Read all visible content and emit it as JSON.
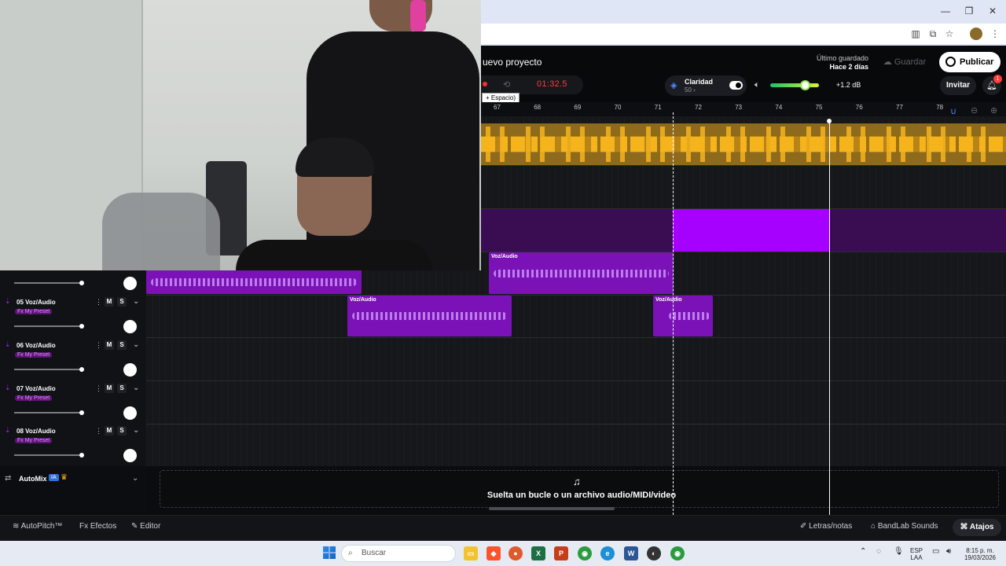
{
  "project": {
    "title": "uevo proyecto",
    "last_saved_label": "Último guardado",
    "last_saved_value": "Hace 2 días",
    "save_label": "Guardar",
    "publish_label": "Publicar",
    "invite_label": "Invitar",
    "notifications_count": "1"
  },
  "transport": {
    "time": "01:32.5",
    "tooltip": "+ Espacio)"
  },
  "clarity": {
    "label": "Claridad",
    "value": "50 ›"
  },
  "master": {
    "gain": "+1.2 dB",
    "volume_level": 0.7
  },
  "ruler": {
    "ticks": [
      "67",
      "68",
      "69",
      "70",
      "71",
      "72",
      "73",
      "74",
      "75",
      "76",
      "77",
      "78"
    ]
  },
  "clips": {
    "label": "Voz/Audio"
  },
  "tracks": [
    {
      "name": "05 Voz/Audio",
      "fx": "Fx My Preset",
      "mute": "M",
      "solo": "S"
    },
    {
      "name": "06 Voz/Audio",
      "fx": "Fx My Preset",
      "mute": "M",
      "solo": "S"
    },
    {
      "name": "07 Voz/Audio",
      "fx": "Fx My Preset",
      "mute": "M",
      "solo": "S"
    },
    {
      "name": "08 Voz/Audio",
      "fx": "Fx My Preset",
      "mute": "M",
      "solo": "S"
    }
  ],
  "automix": {
    "label": "AutoMix",
    "badge": "IA"
  },
  "drop": {
    "text": "Suelta un bucle o un archivo audio/MIDI/video"
  },
  "bottom": {
    "autopitch": "AutoPitch™",
    "effects": "Efectos",
    "editor": "Editor",
    "lyrics": "Letras/notas",
    "sounds": "BandLab Sounds",
    "shortcuts": "Atajos"
  },
  "taskbar": {
    "search_placeholder": "Buscar",
    "lang1": "ESP",
    "lang2": "LAA",
    "time": "8:15 p. m.",
    "date": "19/03/2026"
  },
  "colors": {
    "accent": "#a51dff",
    "gold": "#f5b31c",
    "time_red": "#ff3b3b"
  }
}
